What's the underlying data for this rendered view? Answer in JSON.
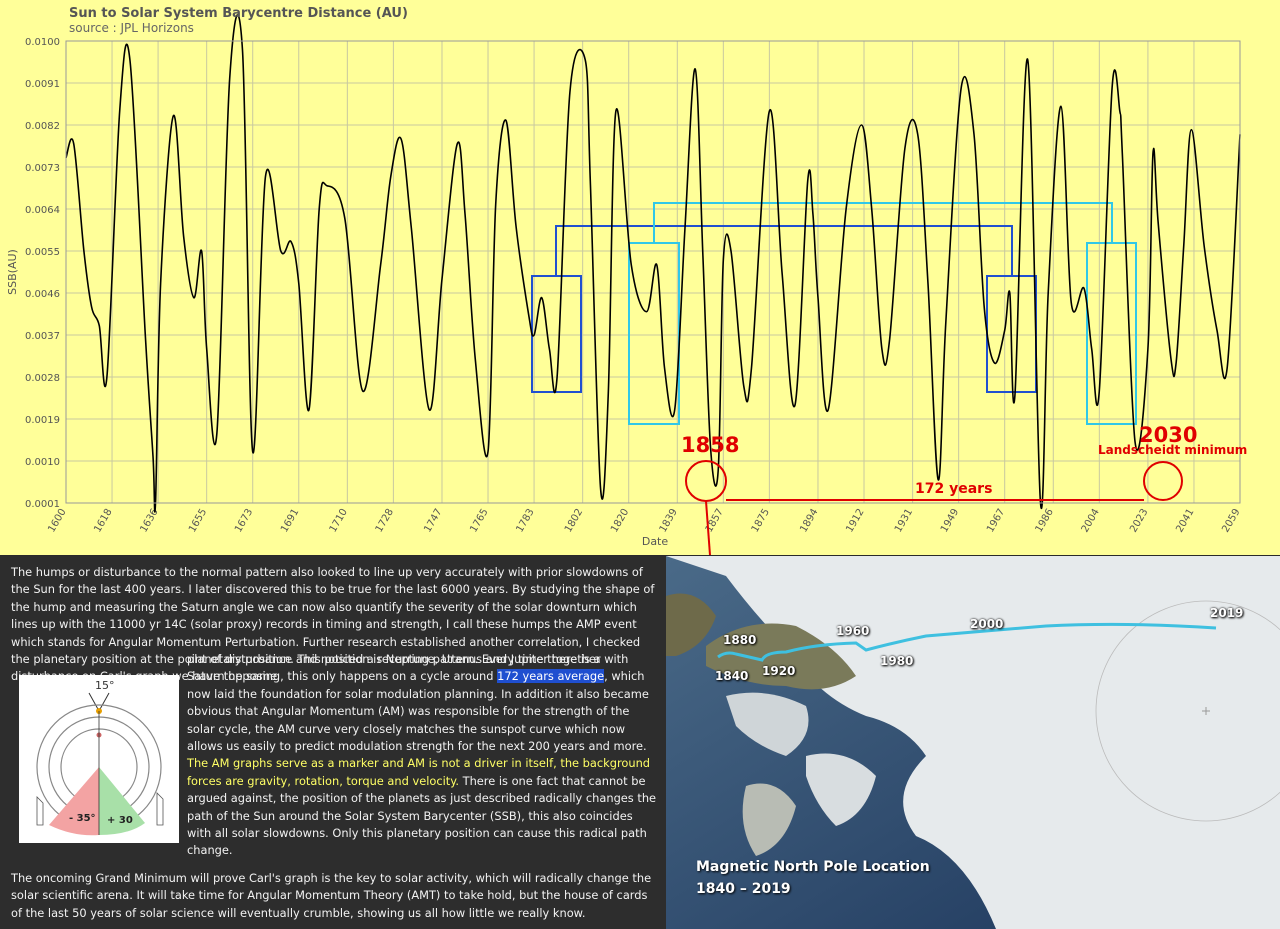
{
  "chart_data": {
    "type": "line",
    "title": "Sun to Solar System Barycentre Distance (AU)",
    "subtitle": "source : JPL Horizons",
    "xlabel": "Date",
    "ylabel": "SSB(AU)",
    "xlim": [
      1600,
      2059
    ],
    "ylim": [
      0.0001,
      0.01
    ],
    "x_ticks": [
      "1600",
      "1618",
      "1636",
      "1655",
      "1673",
      "1691",
      "1710",
      "1728",
      "1747",
      "1765",
      "1783",
      "1802",
      "1820",
      "1839",
      "1857",
      "1875",
      "1894",
      "1912",
      "1931",
      "1949",
      "1967",
      "1986",
      "2004",
      "2023",
      "2041",
      "2059"
    ],
    "y_ticks": [
      "0.0100",
      "0.0091",
      "0.0082",
      "0.0073",
      "0.0064",
      "0.0055",
      "0.0046",
      "0.0037",
      "0.0028",
      "0.0019",
      "0.0010",
      "0.0001"
    ],
    "grid": true,
    "series": [
      {
        "color": "#000000",
        "x": [
          1600,
          1603,
          1607,
          1610,
          1613,
          1616,
          1621,
          1625,
          1631,
          1634,
          1635,
          1637,
          1642,
          1646,
          1650,
          1653,
          1655,
          1659,
          1664,
          1669,
          1673,
          1678,
          1684,
          1688,
          1691,
          1695,
          1699,
          1702,
          1709,
          1716,
          1723,
          1727,
          1731,
          1735,
          1742,
          1747,
          1753,
          1756,
          1760,
          1765,
          1768,
          1772,
          1776,
          1781,
          1783,
          1786,
          1789,
          1792,
          1797,
          1803,
          1805,
          1809,
          1812,
          1815,
          1821,
          1827,
          1831,
          1834,
          1838,
          1842,
          1846,
          1849,
          1852,
          1855,
          1857,
          1860,
          1865,
          1868,
          1875,
          1880,
          1885,
          1890,
          1892,
          1894,
          1898,
          1905,
          1911,
          1915,
          1919,
          1922,
          1928,
          1933,
          1937,
          1941,
          1944,
          1950,
          1955,
          1959,
          1963,
          1967,
          1969,
          1971,
          1976,
          1981,
          1984,
          1989,
          1993,
          1998,
          2001,
          2004,
          2009,
          2012,
          2013,
          2018,
          2023,
          2025,
          2027,
          2032,
          2034,
          2037,
          2040,
          2045,
          2050,
          2054,
          2059
        ],
        "values": [
          0.0075,
          0.0078,
          0.0055,
          0.0043,
          0.0039,
          0.0028,
          0.0085,
          0.0096,
          0.0037,
          0.0011,
          0.0001,
          0.0048,
          0.0084,
          0.0058,
          0.0045,
          0.0055,
          0.0034,
          0.0016,
          0.0092,
          0.0098,
          0.0012,
          0.0071,
          0.0055,
          0.0057,
          0.0048,
          0.0021,
          0.0064,
          0.0069,
          0.0062,
          0.0025,
          0.0052,
          0.0071,
          0.0079,
          0.006,
          0.0021,
          0.0049,
          0.0078,
          0.0063,
          0.0032,
          0.0012,
          0.0065,
          0.0083,
          0.006,
          0.0041,
          0.0037,
          0.0045,
          0.0034,
          0.0028,
          0.0089,
          0.0096,
          0.007,
          0.0004,
          0.0024,
          0.0085,
          0.0052,
          0.0042,
          0.0052,
          0.003,
          0.0021,
          0.006,
          0.0094,
          0.0054,
          0.0013,
          0.0008,
          0.0053,
          0.0055,
          0.0026,
          0.003,
          0.0085,
          0.005,
          0.0022,
          0.007,
          0.0063,
          0.0045,
          0.0021,
          0.0064,
          0.0082,
          0.0064,
          0.0034,
          0.0036,
          0.0077,
          0.008,
          0.0048,
          0.0006,
          0.004,
          0.009,
          0.008,
          0.0043,
          0.0031,
          0.0038,
          0.0046,
          0.0024,
          0.0096,
          0.0001,
          0.0046,
          0.0086,
          0.0044,
          0.0047,
          0.0034,
          0.0025,
          0.009,
          0.0085,
          0.0076,
          0.0014,
          0.0034,
          0.0076,
          0.0061,
          0.0032,
          0.0031,
          0.0056,
          0.0081,
          0.0056,
          0.0038,
          0.003,
          0.008
        ]
      }
    ],
    "annotations": {
      "year_1858": "1858",
      "year_2030": "2030",
      "landscheidt": "Landscheidt minimum",
      "interval": "172 years"
    }
  },
  "text": {
    "para1": "The humps or disturbance to the normal pattern also looked to line up very accurately with prior slowdowns of the Sun for the last 400 years. I later discovered this to be true for the last 6000 years. By studying the shape of the hump and measuring the Saturn angle we can now also quantify the severity of the solar downturn which lines up with the 11000 yr 14C (solar proxy) records in timing and strength, I call these humps the AMP event which stands for Angular Momentum Perturbation. Further research established another correlation, I checked the planetary position at the point of disturbance and noticed a recurring pattern. Every time there is a disturbance on Carl's graph we have the same",
    "para2a": "planetary position. This position is Neptune, Uranus and Jupiter together with Saturn opposing, this only happens on a cycle around ",
    "para2_highlight": "172 years average",
    "para2b": ", which now laid the foundation for solar modulation planning. In addition it also became obvious that Angular Momentum (AM) was responsible for the strength of the solar cycle, the AM curve very closely matches the sunspot curve which now allows us easily to predict modulation strength for the next 200 years and more. ",
    "para2_yellow": "The AM graphs serve as a marker and AM is not a driver in itself, the background forces are gravity, rotation, torque and velocity.",
    "para2c": " There is one fact that cannot be argued against, the position of the planets as just described radically changes the path of the Sun around the Solar System Barycenter (SSB), this also coincides with all solar slowdowns. Only this planetary position can cause this radical path change.",
    "para3": "The oncoming Grand Minimum will prove Carl's graph is the key to solar activity, which will radically change the solar scientific arena. It will take time for Angular Momentum Theory (AMT) to take hold, but the house of cards of the last 50 years of solar science will eventually crumble, showing us all how little we really know."
  },
  "diagram": {
    "angle_top": "15°",
    "angle_left": "- 35°",
    "angle_right": "+ 30"
  },
  "map": {
    "caption_title": "Magnetic North Pole Location",
    "caption_range": "1840 – 2019",
    "years": [
      "1840",
      "1880",
      "1920",
      "1960",
      "1980",
      "2000",
      "2019"
    ]
  }
}
